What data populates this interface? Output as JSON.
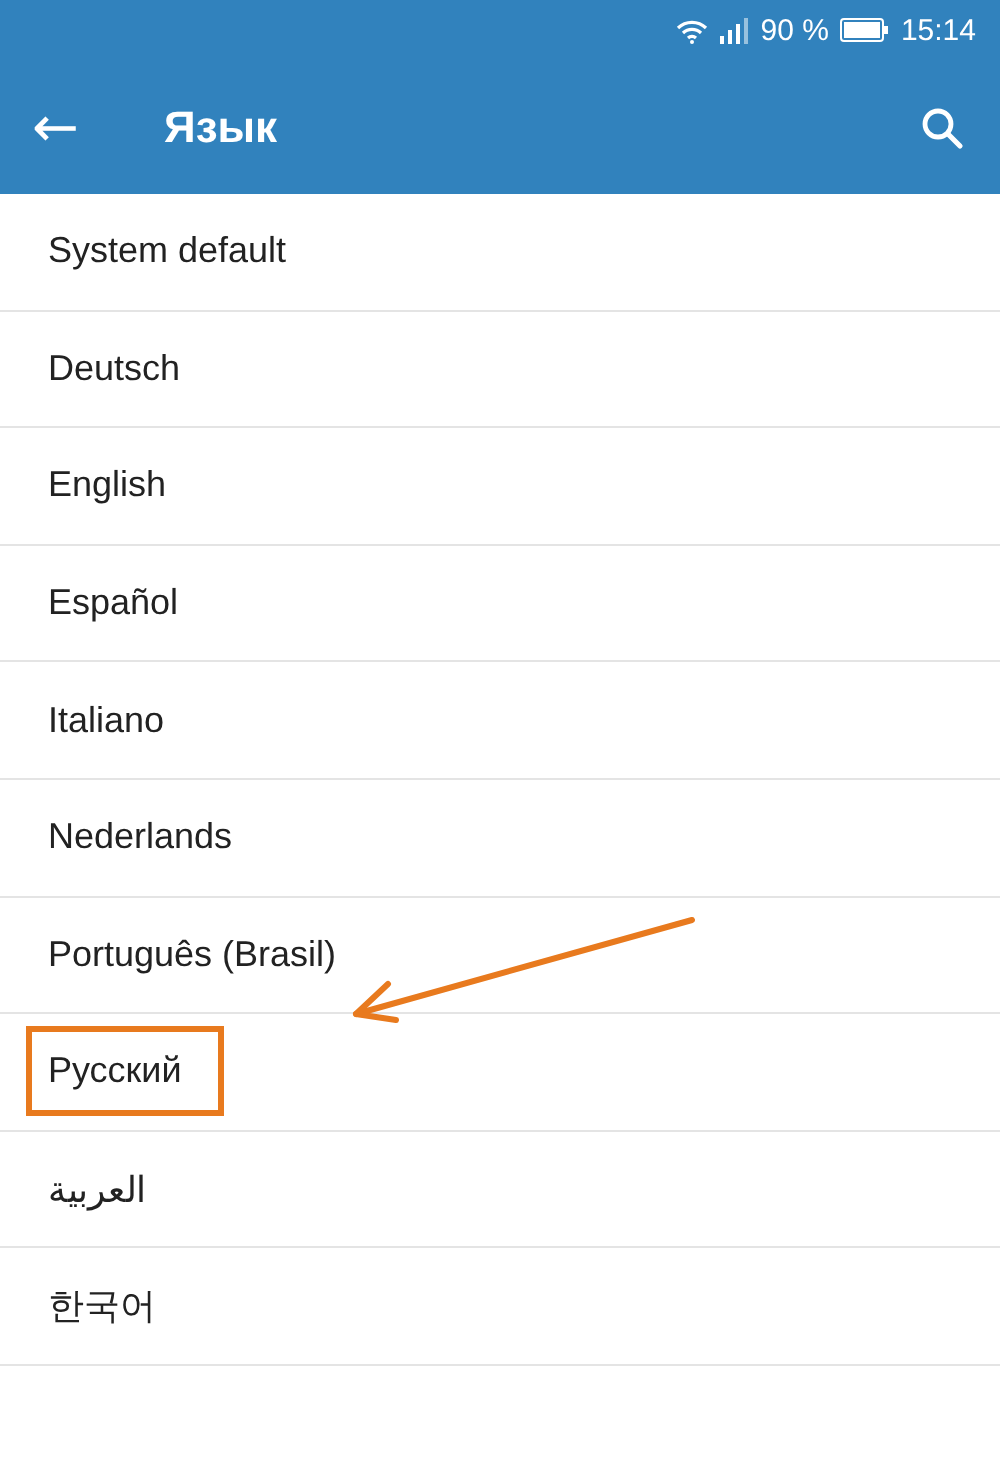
{
  "status_bar": {
    "battery_text": "90 %",
    "time": "15:14"
  },
  "app_bar": {
    "back_icon": "←",
    "title": "Язык"
  },
  "languages": [
    {
      "label": "System default",
      "highlighted": false
    },
    {
      "label": "Deutsch",
      "highlighted": false
    },
    {
      "label": "English",
      "highlighted": false
    },
    {
      "label": "Español",
      "highlighted": false
    },
    {
      "label": "Italiano",
      "highlighted": false
    },
    {
      "label": "Nederlands",
      "highlighted": false
    },
    {
      "label": "Português (Brasil)",
      "highlighted": false
    },
    {
      "label": "Русский",
      "highlighted": true
    },
    {
      "label": "العربية",
      "highlighted": false
    },
    {
      "label": "한국어",
      "highlighted": false
    }
  ]
}
